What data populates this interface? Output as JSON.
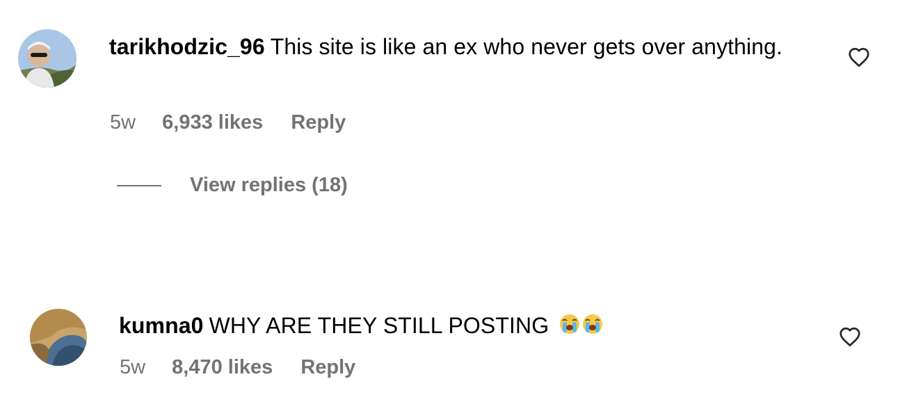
{
  "comments": [
    {
      "username": "tarikhodzic_96",
      "text": "This site is like an ex who never gets over anything.",
      "time": "5w",
      "likes": "6,933 likes",
      "reply_label": "Reply",
      "view_replies": "View replies (18)",
      "like_icon": "heart-outline-icon"
    },
    {
      "username": "kumna0",
      "text": "WHY ARE THEY STILL POSTING",
      "emojis": "😭😭",
      "time": "5w",
      "likes": "8,470 likes",
      "reply_label": "Reply",
      "like_icon": "heart-outline-icon"
    }
  ],
  "colors": {
    "text": "#000000",
    "muted": "#737373",
    "background": "#ffffff"
  }
}
